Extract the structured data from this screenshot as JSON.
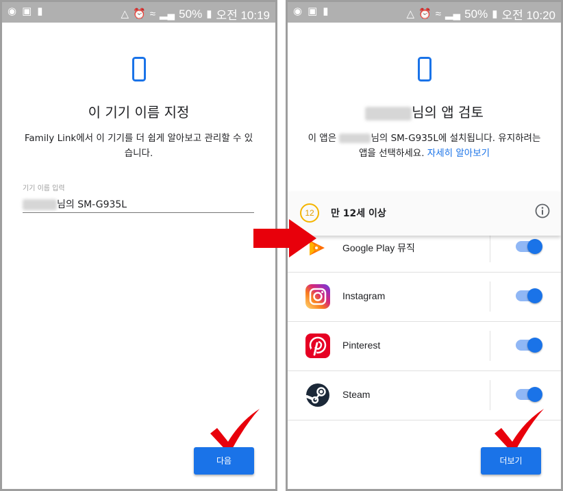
{
  "left": {
    "status": {
      "battery": "50%",
      "time": "오전 10:19"
    },
    "title": "이 기기 이름 지정",
    "description": "Family Link에서 이 기기를 더 쉽게 알아보고 관리할 수 있습니다.",
    "field_label": "기기 이름 입력",
    "field_value_suffix": "님의 SM-G935L",
    "next_button": "다음"
  },
  "right": {
    "status": {
      "battery": "50%",
      "time": "오전 10:20"
    },
    "title_suffix": "님의 앱 검토",
    "desc_prefix": "이 앱은",
    "desc_suffix": "님의 SM-G935L에 설치됩니다. 유지하려는 앱을 선택하세요.",
    "desc_link": "자세히 알아보기",
    "age_badge": "12",
    "age_label": "만 12세 이상",
    "apps": [
      {
        "name": "Google Play 뮤직",
        "enabled": true
      },
      {
        "name": "Instagram",
        "enabled": true
      },
      {
        "name": "Pinterest",
        "enabled": true
      },
      {
        "name": "Steam",
        "enabled": true
      }
    ],
    "more_button": "더보기"
  },
  "colors": {
    "accent": "#1a73e8",
    "check": "#e8000b",
    "arrow": "#e8000b",
    "statusbar": "#b0b0b0"
  }
}
